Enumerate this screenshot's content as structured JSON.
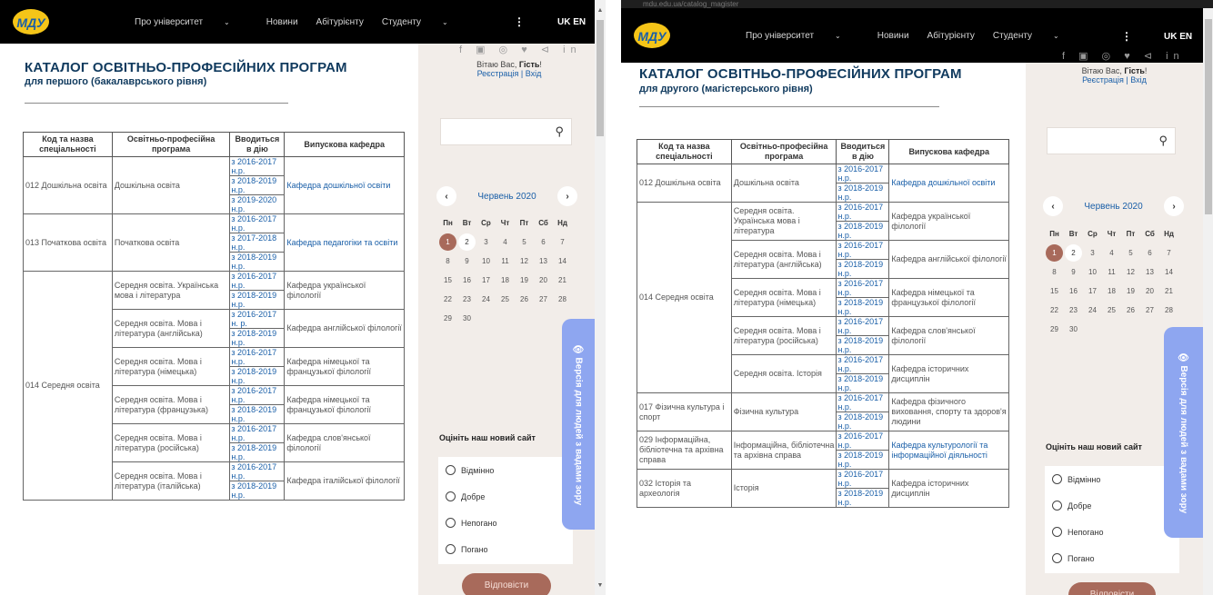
{
  "nav": {
    "about": "Про університет",
    "news": "Новини",
    "applicant": "Абітурієнту",
    "student": "Студенту",
    "kebab": "⋮",
    "lang": "UK EN",
    "logo_text": "МДУ"
  },
  "sidebar": {
    "social": "f ▣ ◎ ♥ ⊲ in",
    "greeting": "Вітаю Вас, ",
    "guest": "Гість",
    "greeting_end": "!",
    "register_login": "Реєстрація | Вхід",
    "search_icon": "search-icon",
    "calendar": {
      "month": "Червень 2020",
      "prev": "‹",
      "next": "›",
      "days": [
        "Пн",
        "Вт",
        "Ср",
        "Чт",
        "Пт",
        "Сб",
        "Нд"
      ],
      "weeks": [
        [
          "1",
          "2",
          "3",
          "4",
          "5",
          "6",
          "7"
        ],
        [
          "8",
          "9",
          "10",
          "11",
          "12",
          "13",
          "14"
        ],
        [
          "15",
          "16",
          "17",
          "18",
          "19",
          "20",
          "21"
        ],
        [
          "22",
          "23",
          "24",
          "25",
          "26",
          "27",
          "28"
        ],
        [
          "29",
          "30",
          "",
          "",
          "",
          "",
          ""
        ]
      ]
    },
    "poll": {
      "title": "Оцініть наш новий сайт",
      "options": [
        "Відмінно",
        "Добре",
        "Непогано",
        "Погано"
      ],
      "button": "Відповісти"
    },
    "accessibility": "👁 Версія для людей з вадами зору"
  },
  "left": {
    "title": "КАТАЛОГ ОСВІТНЬО-ПРОФЕСІЙНИХ ПРОГРАМ",
    "subtitle": "для першого (бакалаврського рівня)",
    "headers": [
      "Код та назва спеціальності",
      "Освітньо-професійна програма",
      "Вводиться в дію",
      "Випускова кафедра"
    ],
    "groups": [
      {
        "spec": "012 Дошкільна освіта",
        "programs": [
          {
            "name": "Дошкільна освіта",
            "years": [
              "з 2016-2017 н.р.",
              "з 2018-2019 н.р.",
              "з 2019-2020 н.р."
            ],
            "dept": "Кафедра дошкільної освіти",
            "dept_link": true
          }
        ]
      },
      {
        "spec": "013 Початкова освіта",
        "programs": [
          {
            "name": "Початкова освіта",
            "years": [
              "з 2016-2017 н.р.",
              "з 2017-2018 н.р.",
              "з 2018-2019 н.р."
            ],
            "dept": "Кафедра педагогіки та освіти",
            "dept_link": true
          }
        ]
      },
      {
        "spec": "014 Середня освіта",
        "programs": [
          {
            "name": "Середня освіта. Українська мова і література",
            "years": [
              "з 2016-2017 н.р.",
              "з 2018-2019 н.р."
            ],
            "dept": "Кафедра української філології",
            "dept_link": false
          },
          {
            "name": "Середня освіта. Мова і література (англійська)",
            "years": [
              "з 2016-2017 н. р.",
              "з 2018-2019 н.р."
            ],
            "dept": "Кафедра англійської філології",
            "dept_link": false
          },
          {
            "name": "Середня освіта. Мова і література (німецька)",
            "years": [
              "з 2016-2017 н.р.",
              "з 2018-2019 н.р."
            ],
            "dept": "Кафедра німецької та французької філології",
            "dept_link": false
          },
          {
            "name": "Середня освіта. Мова і література (французька)",
            "years": [
              "з 2016-2017 н.р.",
              "з 2018-2019 н.р."
            ],
            "dept": "Кафедра німецької та французької філології",
            "dept_link": false
          },
          {
            "name": "Середня освіта. Мова і література (російська)",
            "years": [
              "з 2016-2017 н.р.",
              "з 2018-2019 н.р."
            ],
            "dept": "Кафедра слов'янської філології",
            "dept_link": false
          },
          {
            "name": "Середня освіта. Мова і література (італійська)",
            "years": [
              "з 2016-2017 н.р.",
              "з 2018-2019 н.р."
            ],
            "dept": "Кафедра італійської філології",
            "dept_link": false
          }
        ]
      }
    ]
  },
  "right": {
    "title": "КАТАЛОГ ОСВІТНЬО-ПРОФЕСІЙНИХ ПРОГРАМ",
    "subtitle": "для другого (магістерського рівня)",
    "headers": [
      "Код та назва спеціальності",
      "Освітньо-професійна програма",
      "Вводиться в дію",
      "Випускова кафедра"
    ],
    "groups": [
      {
        "spec": "012 Дошкільна освіта",
        "programs": [
          {
            "name": "Дошкільна освіта",
            "years": [
              "з 2016-2017 н.р.",
              "з 2018-2019 н.р."
            ],
            "dept": "Кафедра дошкільної освіти",
            "dept_link": true
          }
        ]
      },
      {
        "spec": "014 Середня освіта",
        "programs": [
          {
            "name": "Середня освіта. Українська мова і література",
            "years": [
              "з 2016-2017 н.р.",
              "з 2018-2019 н.р."
            ],
            "dept": "Кафедра української філології",
            "dept_link": false
          },
          {
            "name": "Середня освіта. Мова і література (англійська)",
            "years": [
              "з 2016-2017 н.р.",
              "з 2018-2019 н.р."
            ],
            "dept": "Кафедра англійської філології",
            "dept_link": false
          },
          {
            "name": "Середня освіта. Мова і література (німецька)",
            "years": [
              "з 2016-2017 н.р.",
              "з 2018-2019 н.р."
            ],
            "dept": "Кафедра німецької та французької філології",
            "dept_link": false
          },
          {
            "name": "Середня освіта. Мова і література (російська)",
            "years": [
              "з 2016-2017 н.р.",
              "з 2018-2019 н.р."
            ],
            "dept": "Кафедра слов'янської філології",
            "dept_link": false
          },
          {
            "name": "Середня освіта. Історія",
            "years": [
              "з 2016-2017 н.р.",
              "з 2018-2019 н.р."
            ],
            "dept": "Кафедра історичних дисциплін",
            "dept_link": false
          }
        ]
      },
      {
        "spec": "017 Фізична культура і спорт",
        "programs": [
          {
            "name": "Фізична культура",
            "years": [
              "з 2016-2017 н.р.",
              "з 2018-2019 н.р."
            ],
            "dept": "Кафедра фізичного виховання, спорту та здоров'я людини",
            "dept_link": false
          }
        ]
      },
      {
        "spec": "029 Інформаційна, бібліотечна та архівна справа",
        "programs": [
          {
            "name": "Інформаційна, бібліотечна та архівна справа",
            "years": [
              "з 2016-2017 н.р.",
              "з 2018-2019 н.р."
            ],
            "dept": "Кафедра культурології та інформаційної діяльності",
            "dept_link": true
          }
        ]
      },
      {
        "spec": "032 Історія та археологія",
        "programs": [
          {
            "name": "Історія",
            "years": [
              "з 2016-2017 н.р.",
              "з 2018-2019 н.р."
            ],
            "dept": "Кафедра історичних дисциплін",
            "dept_link": false
          }
        ]
      }
    ]
  },
  "browser": {
    "url": "mdu.edu.ua/catalog_magister"
  }
}
